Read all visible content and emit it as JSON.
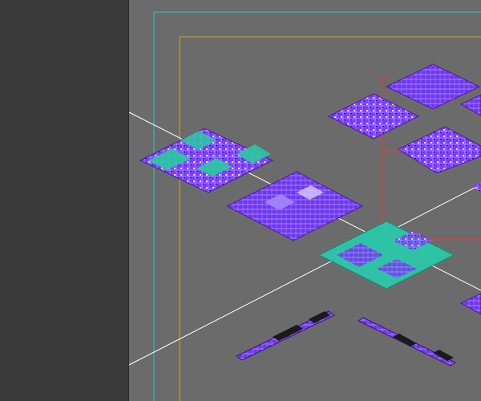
{
  "app": {
    "colors": {
      "panel_bg": "#3a3a3a",
      "viewport_bg": "#6b6b6b",
      "safe_frame_outer": "#27c4c8",
      "safe_frame_inner": "#c8a020",
      "grid_axis": "#ffffff",
      "gizmo_axis": "#ff3030",
      "board_purple": "#7a3cff",
      "board_teal": "#2ec3a4",
      "board_dark": "#5a1f9a",
      "connector_dark": "#1a1a1a"
    }
  },
  "viewport": {
    "icons": [
      "perspective-grid",
      "transform-gizmo"
    ]
  }
}
